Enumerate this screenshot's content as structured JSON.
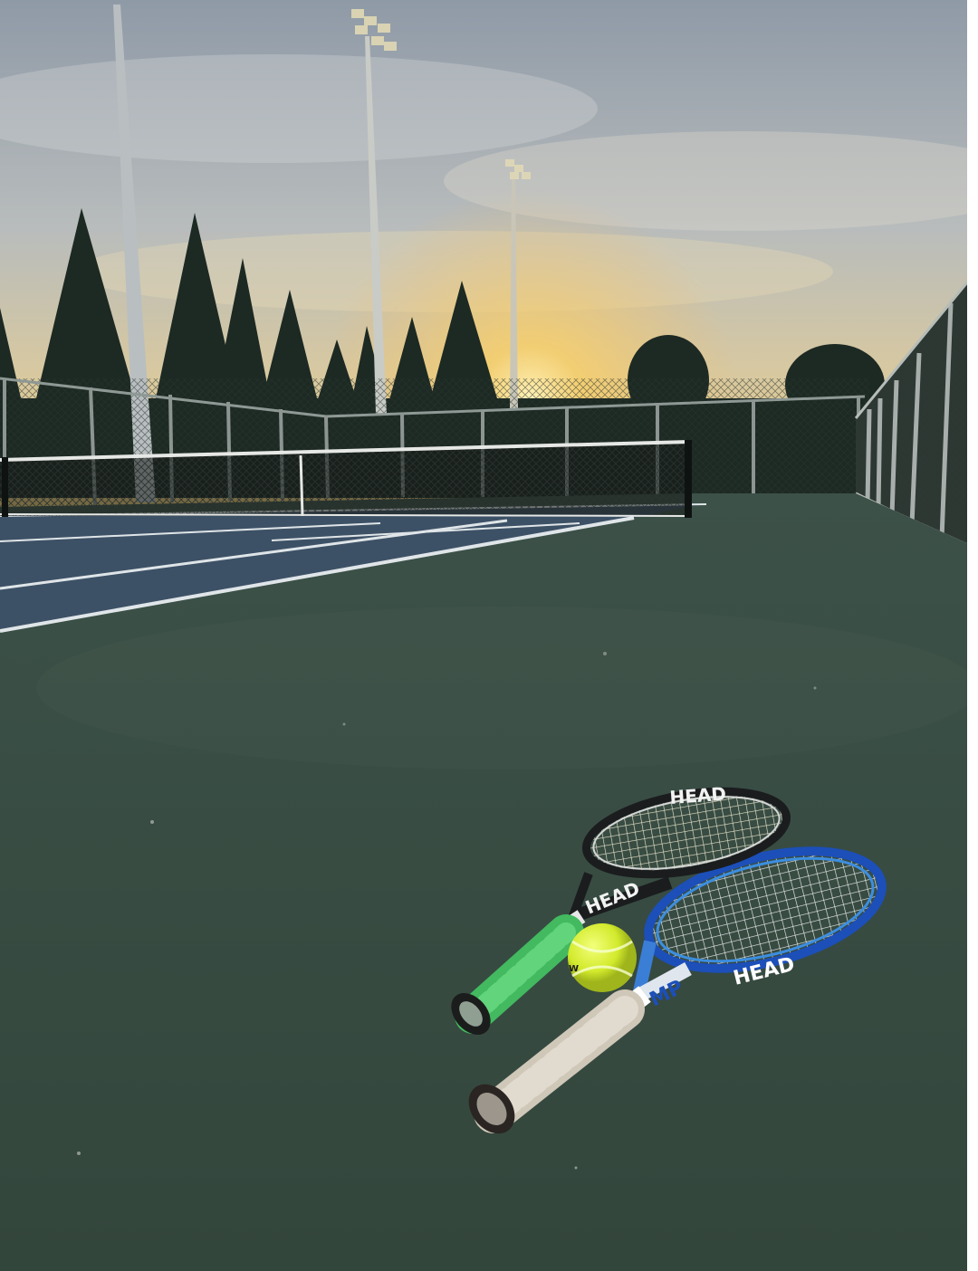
{
  "scene": {
    "description_colors": {
      "sky_top": "#9aa6b3",
      "sky_mid": "#c9c3b4",
      "sky_glow": "#f3c46a",
      "court_green": "#3e5348",
      "court_blue": "#3f5266",
      "line_white": "#e8ecef",
      "fence": "#4b5a55",
      "tree": "#1f2a24",
      "ball": "#d8f03a",
      "racket_black_frame": "#1a1c1e",
      "racket_blue_frame": "#1f4fb7",
      "grip_green": "#4fc96a",
      "grip_white": "#d8d2c8"
    },
    "brand_marks": {
      "racket_1_brand": "HEAD",
      "racket_2_brand": "HEAD",
      "racket_2_model": "MP",
      "ball_brand": "Wilson"
    }
  }
}
